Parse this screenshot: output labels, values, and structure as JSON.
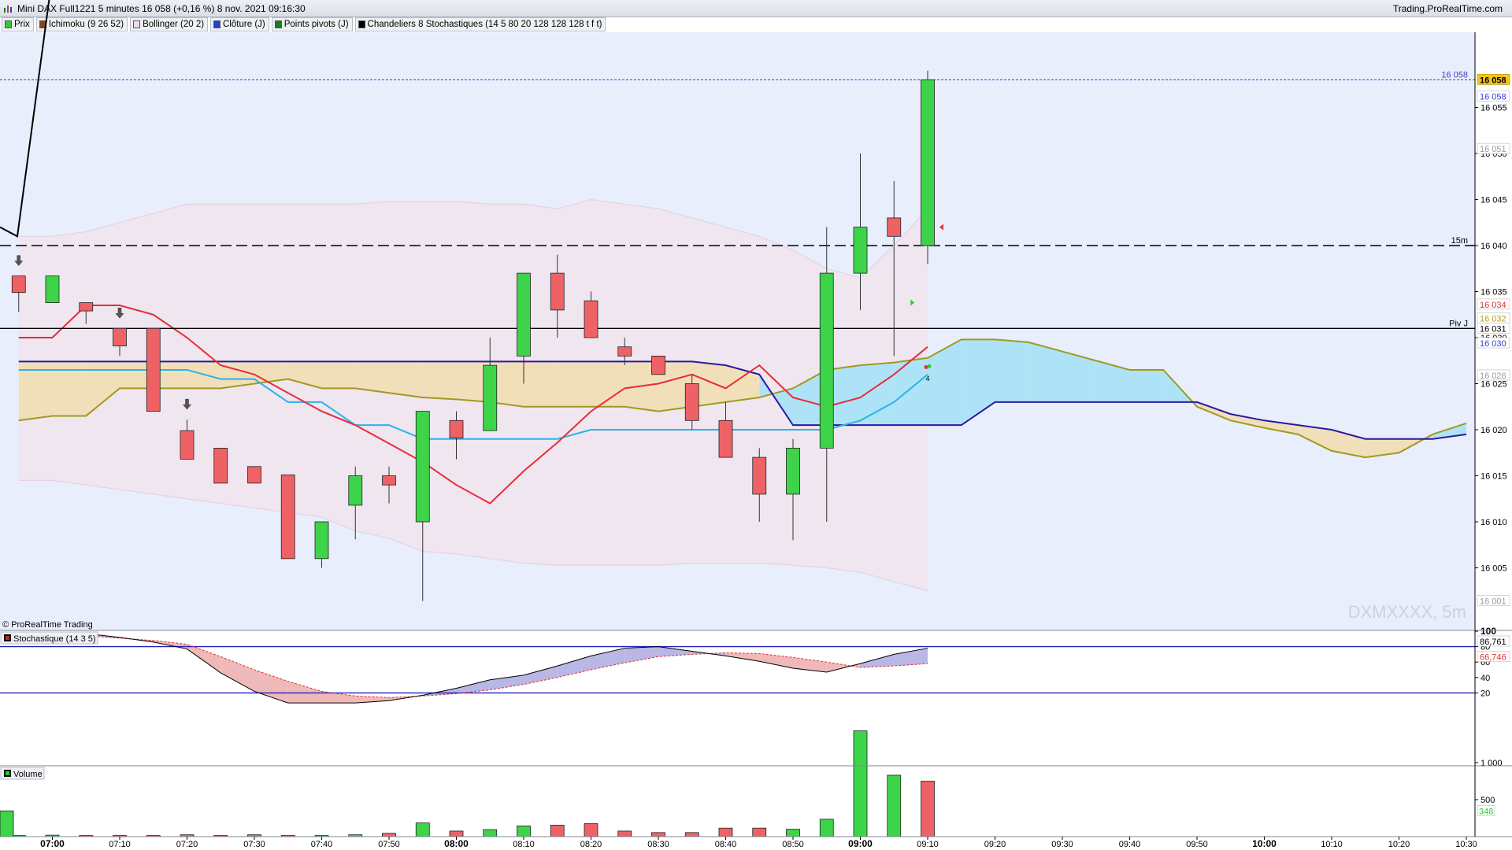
{
  "window": {
    "title": "Mini DAX Full1221 5 minutes 16 058 (+0,16 %) 8 nov. 2021 09:16:30",
    "site": "Trading.ProRealTime.com"
  },
  "indicators": [
    {
      "label": "Prix",
      "color": "#2ecc2e"
    },
    {
      "label": "Ichimoku (9 26 52)",
      "color": "#8b4513"
    },
    {
      "label": "Bollinger (20 2)",
      "color": "#e8dde8"
    },
    {
      "label": "Clôture (J)",
      "color": "#1f3fd6"
    },
    {
      "label": "Points pivots (J)",
      "color": "#1f7a1f"
    },
    {
      "label": "Chandeliers 8 Stochastiques (14 5 80 20 128 128 128 t f t)",
      "color": "#000000"
    }
  ],
  "panels": {
    "copyright": "© ProRealTime Trading",
    "watermark": "DXMXXXX, 5m",
    "stoch_label": "Stochastique (14 3 5)",
    "volume_label": "Volume",
    "stoch_color": "#b03030",
    "volume_color": "#2ecc2e"
  },
  "chart_data": {
    "type": "candlestick",
    "x_ticks": [
      {
        "label": "07:00",
        "bold": true
      },
      {
        "label": "07:10"
      },
      {
        "label": "07:20"
      },
      {
        "label": "07:30"
      },
      {
        "label": "07:40"
      },
      {
        "label": "07:50"
      },
      {
        "label": "08:00",
        "bold": true
      },
      {
        "label": "08:10"
      },
      {
        "label": "08:20"
      },
      {
        "label": "08:30"
      },
      {
        "label": "08:40"
      },
      {
        "label": "08:50"
      },
      {
        "label": "09:00",
        "bold": true
      },
      {
        "label": "09:10"
      },
      {
        "label": "09:20"
      },
      {
        "label": "09:30"
      },
      {
        "label": "09:40"
      },
      {
        "label": "09:50"
      },
      {
        "label": "10:00",
        "bold": true
      },
      {
        "label": "10:10"
      },
      {
        "label": "10:20"
      },
      {
        "label": "10:30"
      }
    ],
    "y_range": [
      16000,
      16060
    ],
    "y_ticks": [
      "16 005",
      "16 010",
      "16 015",
      "16 020",
      "16 025",
      "16 030",
      "16 035",
      "16 040",
      "16 045",
      "16 050",
      "16 055"
    ],
    "candles": [
      {
        "t": "06:55",
        "o": 16036.7,
        "h": 16036.7,
        "l": 16032.8,
        "c": 16034.9
      },
      {
        "t": "07:00",
        "o": 16033.8,
        "h": 16036.7,
        "l": 16033.8,
        "c": 16036.7
      },
      {
        "t": "07:05",
        "o": 16033.8,
        "h": 16033.8,
        "l": 16031.5,
        "c": 16032.9
      },
      {
        "t": "07:10",
        "o": 16031.0,
        "h": 16031.0,
        "l": 16028.0,
        "c": 16029.1
      },
      {
        "t": "07:15",
        "o": 16031.0,
        "h": 16031.0,
        "l": 16022.0,
        "c": 16022.0
      },
      {
        "t": "07:20",
        "o": 16019.9,
        "h": 16021.1,
        "l": 16016.8,
        "c": 16016.8
      },
      {
        "t": "07:25",
        "o": 16018.0,
        "h": 16018.0,
        "l": 16014.2,
        "c": 16014.2
      },
      {
        "t": "07:30",
        "o": 16016.0,
        "h": 16016.0,
        "l": 16014.2,
        "c": 16014.2
      },
      {
        "t": "07:35",
        "o": 16015.1,
        "h": 16015.1,
        "l": 16006.0,
        "c": 16006.0
      },
      {
        "t": "07:40",
        "o": 16006.0,
        "h": 16010.0,
        "l": 16005.0,
        "c": 16010.0
      },
      {
        "t": "07:45",
        "o": 16011.8,
        "h": 16016.0,
        "l": 16008.1,
        "c": 16015.0
      },
      {
        "t": "07:50",
        "o": 16015.0,
        "h": 16016.0,
        "l": 16012.0,
        "c": 16014.0
      },
      {
        "t": "07:55",
        "o": 16010.0,
        "h": 16022.0,
        "l": 16001.4,
        "c": 16022.0
      },
      {
        "t": "08:00",
        "o": 16021.0,
        "h": 16022.0,
        "l": 16016.8,
        "c": 16019.1
      },
      {
        "t": "08:05",
        "o": 16019.9,
        "h": 16030.0,
        "l": 16019.9,
        "c": 16027.0
      },
      {
        "t": "08:10",
        "o": 16028.0,
        "h": 16037.0,
        "l": 16025.0,
        "c": 16037.0
      },
      {
        "t": "08:15",
        "o": 16037.0,
        "h": 16039.0,
        "l": 16030.0,
        "c": 16033.0
      },
      {
        "t": "08:20",
        "o": 16034.0,
        "h": 16035.0,
        "l": 16030.0,
        "c": 16030.0
      },
      {
        "t": "08:25",
        "o": 16029.0,
        "h": 16030.0,
        "l": 16027.0,
        "c": 16028.0
      },
      {
        "t": "08:30",
        "o": 16028.0,
        "h": 16028.0,
        "l": 16026.0,
        "c": 16026.0
      },
      {
        "t": "08:35",
        "o": 16025.0,
        "h": 16026.0,
        "l": 16020.0,
        "c": 16021.0
      },
      {
        "t": "08:40",
        "o": 16021.0,
        "h": 16023.0,
        "l": 16017.0,
        "c": 16017.0
      },
      {
        "t": "08:45",
        "o": 16017.0,
        "h": 16018.0,
        "l": 16010.0,
        "c": 16013.0
      },
      {
        "t": "08:50",
        "o": 16013.0,
        "h": 16019.0,
        "l": 16008.0,
        "c": 16018.0
      },
      {
        "t": "08:55",
        "o": 16018.0,
        "h": 16042.0,
        "l": 16010.0,
        "c": 16037.0
      },
      {
        "t": "09:00",
        "o": 16037.0,
        "h": 16050.0,
        "l": 16033.0,
        "c": 16042.0
      },
      {
        "t": "09:05",
        "o": 16043.0,
        "h": 16047.0,
        "l": 16028.0,
        "c": 16041.0
      },
      {
        "t": "09:10",
        "o": 16040.0,
        "h": 16059.0,
        "l": 16038.0,
        "c": 16058.0
      }
    ],
    "price_tags": [
      {
        "label": "16 058",
        "v": 16058,
        "bg": "#f5c518",
        "fg": "#000000",
        "bold": true
      },
      {
        "label": "16 058",
        "v": 16056.2,
        "bg": "#ffffff",
        "fg": "#3a3adb",
        "bold": false
      },
      {
        "label": "16 051",
        "v": 16050.5,
        "bg": "#ffffff",
        "fg": "#9a9a9a",
        "bold": false
      },
      {
        "label": "16 034",
        "v": 16033.6,
        "bg": "#ffffff",
        "fg": "#e03030",
        "bold": false
      },
      {
        "label": "16 032",
        "v": 16032.1,
        "bg": "#ffffff",
        "fg": "#b8a020",
        "bold": false
      },
      {
        "label": "16 031",
        "v": 16031.0,
        "bg": "#ffffff",
        "fg": "#000000",
        "bold": false
      },
      {
        "label": "16 030",
        "v": 16029.4,
        "bg": "#ffffff",
        "fg": "#3a3adb",
        "bold": false
      },
      {
        "label": "16 026",
        "v": 16025.9,
        "bg": "#ffffff",
        "fg": "#9a9a9a",
        "bold": false
      },
      {
        "label": "16 001",
        "v": 16001.4,
        "bg": "#ffffff",
        "fg": "#9a9a9a",
        "bold": false
      }
    ],
    "levels": [
      {
        "label": "16 058",
        "v": 16058,
        "style": "dotted",
        "color": "#4040c0",
        "text_color": "#4040c0"
      },
      {
        "label": "15m",
        "v": 16040,
        "style": "dashed",
        "color": "#000000",
        "text_color": "#000000"
      },
      {
        "label": "Piv J",
        "v": 16031,
        "style": "solid",
        "color": "#000000",
        "text_color": "#000000"
      }
    ],
    "bollinger": {
      "upper": [
        16041,
        16041,
        16041.5,
        16042.5,
        16043.5,
        16044.5,
        16044.5,
        16044.5,
        16044.5,
        16044.5,
        16044.5,
        16044.8,
        16044.8,
        16044.8,
        16044.5,
        16044.5,
        16044.0,
        16045.0,
        16044.5,
        16044.0,
        16043.0,
        16042.0,
        16041.0,
        16039.5,
        16037.5,
        16036.5,
        16040.0,
        16044.0,
        16050.0
      ],
      "lower": [
        16014.5,
        16014.5,
        16014.0,
        16013.5,
        16013.0,
        16012.5,
        16012.0,
        16011.5,
        16011.0,
        16010.5,
        16009.0,
        16008.2,
        16006.8,
        16006.5,
        16006.0,
        16005.5,
        16005.3,
        16005.3,
        16005.3,
        16005.3,
        16005.5,
        16005.5,
        16005.5,
        16005.3,
        16005.0,
        16004.5,
        16003.5,
        16002.5,
        16001.0
      ]
    },
    "ichimoku": {
      "tenkan": [
        16030,
        16030,
        16033.5,
        16033.5,
        16032.5,
        16030,
        16027,
        16026,
        16024,
        16022,
        16020.5,
        16018.5,
        16016.5,
        16014,
        16012,
        16015.5,
        16018.6,
        16022,
        16024.5,
        16025,
        16026,
        16024.5,
        16027,
        16023.5,
        16022.5,
        16023.5,
        16026,
        16029,
        16034
      ],
      "kijun": [
        16026.5,
        16026.5,
        16026.5,
        16026.5,
        16026.5,
        16026.5,
        16025.5,
        16025.5,
        16023,
        16023,
        16020.5,
        16020.5,
        16019,
        16019,
        16019,
        16019,
        16019,
        16020,
        16020,
        16020,
        16020,
        16020,
        16020,
        16020,
        16020,
        16021,
        16023,
        16026,
        16030.3
      ],
      "chikou": [
        16041,
        16042
      ],
      "cloud": {
        "x": [
          "06:55",
          "07:00",
          "07:05",
          "07:10",
          "07:15",
          "07:20",
          "07:25",
          "07:30",
          "07:35",
          "07:40",
          "07:45",
          "07:50",
          "07:55",
          "08:00",
          "08:05",
          "08:10",
          "08:15",
          "08:20",
          "08:25",
          "08:30",
          "08:35",
          "08:40",
          "08:45",
          "08:50",
          "08:55",
          "09:00",
          "09:05",
          "09:10",
          "09:15",
          "09:20",
          "09:25",
          "09:30",
          "09:35",
          "09:40",
          "09:45",
          "09:50",
          "09:55",
          "10:00",
          "10:05",
          "10:10",
          "10:15",
          "10:20",
          "10:25",
          "10:30"
        ],
        "span_a": [
          16021,
          16021.5,
          16021.5,
          16024.5,
          16024.5,
          16024.5,
          16024.5,
          16025,
          16025.5,
          16024.5,
          16024.5,
          16024,
          16023.5,
          16023.3,
          16023,
          16022.5,
          16022.5,
          16022.5,
          16022.5,
          16022,
          16022.5,
          16023,
          16023.5,
          16024.5,
          16026.5,
          16027,
          16027.3,
          16027.8,
          16029.8,
          16029.8,
          16029.5,
          16028.5,
          16027.5,
          16026.5,
          16026.5,
          16022.5,
          16021,
          16020.2,
          16019.5,
          16017.7,
          16017,
          16017.5,
          16019.5,
          16020.7
        ],
        "span_b": [
          16027.4,
          16027.4,
          16027.4,
          16027.4,
          16027.4,
          16027.4,
          16027.4,
          16027.4,
          16027.4,
          16027.4,
          16027.4,
          16027.4,
          16027.4,
          16027.4,
          16027.4,
          16027.4,
          16027.4,
          16027.4,
          16027.4,
          16027.4,
          16027.4,
          16027.0,
          16026.0,
          16020.5,
          16020.5,
          16020.5,
          16020.5,
          16020.5,
          16020.5,
          16023,
          16023,
          16023,
          16023,
          16023,
          16023,
          16023,
          16021.7,
          16021,
          16020.5,
          16020,
          16019,
          16019,
          16019,
          16019.5,
          16020
        ]
      }
    },
    "signals": {
      "down_arrows": [
        "06:55",
        "07:10",
        "07:20"
      ],
      "right_marker": "09:05",
      "left_marker": "09:10",
      "label_4": "4"
    },
    "stochastic": {
      "y_range": [
        0,
        100
      ],
      "y_ticks": [
        "100",
        "80",
        "60",
        "40",
        "20"
      ],
      "levels": [
        80,
        20
      ],
      "k": [
        95,
        99,
        97,
        92,
        86,
        77,
        46,
        22,
        7,
        7,
        7,
        10,
        17,
        26,
        37,
        43,
        55,
        68,
        78,
        80,
        74,
        68,
        61,
        52,
        47,
        58,
        70,
        78,
        86.761
      ],
      "d": [
        98,
        97,
        94,
        91,
        88,
        83,
        67,
        50,
        35,
        22,
        16,
        14,
        16,
        19,
        24,
        31,
        40,
        50,
        59,
        67,
        70,
        72,
        71,
        66,
        60,
        53,
        55,
        58,
        66.746
      ],
      "tags": [
        {
          "label": "86,761",
          "v": 86.761,
          "fg": "#000000"
        },
        {
          "label": "66,746",
          "v": 66.746,
          "fg": "#e03030"
        }
      ]
    },
    "volume": {
      "y_ticks": [
        {
          "label": "1 000",
          "v": 1000
        },
        {
          "label": "500",
          "v": 500
        }
      ],
      "values": [
        15,
        20,
        15,
        15,
        15,
        25,
        15,
        25,
        15,
        15,
        25,
        45,
        185,
        75,
        95,
        145,
        155,
        175,
        75,
        55,
        55,
        115,
        115,
        100,
        235,
        1430,
        830,
        750,
        348
      ],
      "colors": [
        "up",
        "up",
        "down",
        "down",
        "down",
        "down",
        "down",
        "down",
        "down",
        "up",
        "up",
        "down",
        "up",
        "down",
        "up",
        "up",
        "down",
        "down",
        "down",
        "down",
        "down",
        "down",
        "down",
        "up",
        "up",
        "up",
        "up",
        "down",
        "up"
      ],
      "tag": {
        "label": "348",
        "v": 348
      }
    }
  }
}
